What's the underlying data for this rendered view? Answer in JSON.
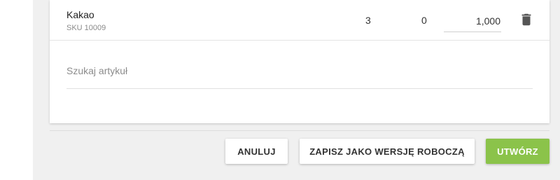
{
  "item": {
    "name": "Kakao",
    "sku": "SKU 10009",
    "col_a": "3",
    "col_b": "0",
    "quantity": "1,000"
  },
  "icons": {
    "delete": "trash-icon"
  },
  "search": {
    "placeholder": "Szukaj artykuł",
    "value": ""
  },
  "actions": {
    "cancel_label": "ANULUJ",
    "draft_label": "ZAPISZ JAKO WERSJĘ ROBOCZĄ",
    "create_label": "UTWÓRZ"
  },
  "colors": {
    "primary": "#8bc34a",
    "background": "#f0f0f0",
    "card": "#ffffff"
  }
}
